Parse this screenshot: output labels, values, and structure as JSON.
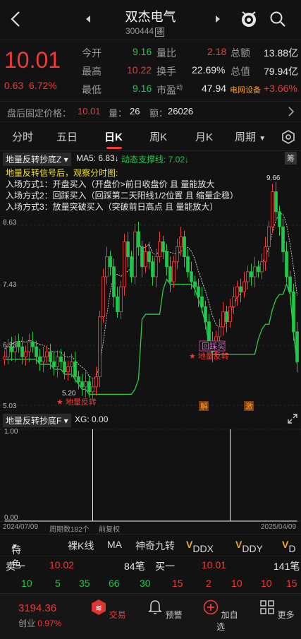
{
  "header": {
    "title": "双杰电气",
    "code": "300444",
    "tong_badge": "通"
  },
  "quote": {
    "price": "10.01",
    "change": "0.63",
    "change_pct": "6.72%",
    "open_label": "今开",
    "open": "9.16",
    "high_label": "最高",
    "high": "10.22",
    "low_label": "最低",
    "low": "9.16",
    "ratio_label": "量比",
    "ratio": "2.18",
    "turnover_label": "换手",
    "turnover": "22.69%",
    "pe_label": "市盈",
    "pe_sup": "动",
    "pe": "47.94",
    "amount_label": "总额",
    "amount": "13.88亿",
    "mktcap_label": "总值",
    "mktcap": "79.94亿",
    "sector": "电网设备",
    "sector_chg": "+3.66%"
  },
  "afterhours": {
    "label": "盘后固定价格：",
    "price": "10.01",
    "vol_label": "量：",
    "vol": "26",
    "amt_label": "额：",
    "amt": "26026"
  },
  "tabs": [
    "分时",
    "五日",
    "日K",
    "周K",
    "月K",
    "周期"
  ],
  "indicator": {
    "name": "地量反转抄底Z",
    "ma5": "MA5: 6.83↓",
    "support": "动态支撑线: 7.02↓",
    "notes": [
      "地量反转信号后，观察分时图:",
      "入场方式1：开盘买入（开盘价>前日收盘价 且 量能放大",
      "入场方式2：回踩买入（回踩第二天阳线1/2位置 且 缩量企稳）",
      "入场方式3：放量突破买入（突破前日高点 且 量能放大）"
    ],
    "right_badge": "筹"
  },
  "chart_labels": {
    "y_top": "8.63",
    "y_mid": "7.43",
    "y_low": "6.23",
    "y_bottom": "5.03",
    "high": "9.66",
    "low": "5.20",
    "signal1": "★ 地量反转",
    "signal2": "★ 地量反转",
    "retest": "回踩买",
    "mark1": "解",
    "mark2": "激"
  },
  "sub_indicator": {
    "name": "地量反转抄底F",
    "xg": "XG: 0.00",
    "y1": "1.00",
    "y0": "0.00",
    "date_start": "2024/07/09",
    "period": "周期数182个",
    "adj": "前复权",
    "date_end": "2025/04/09"
  },
  "toolbar": {
    "feature": "特色",
    "items": [
      "裸K线",
      "MA",
      "神奇九转",
      "DDX",
      "DDY",
      "D"
    ]
  },
  "orderbook": {
    "sell_label": "卖一",
    "sell_price": "10.02",
    "sell_vol": "84笔",
    "buy_label": "买一",
    "buy_price": "10.01",
    "buy_vol": "141笔",
    "sell_nums": [
      "10",
      "5",
      "35",
      "66",
      "30"
    ],
    "buy_nums": [
      "15",
      "2",
      "10",
      "10",
      "15"
    ]
  },
  "nav": {
    "index_value": "3194.36",
    "index_name": "创业",
    "index_chg": "0.97%",
    "items": [
      "交易",
      "预警",
      "加自选",
      "更多"
    ]
  },
  "chart_data": {
    "type": "candlestick",
    "title": "",
    "y_ticks": [
      5.03,
      6.23,
      7.43,
      8.63
    ],
    "ylim": [
      5.03,
      9.83
    ],
    "x_range": [
      "2024/07/09",
      "2025/04/09"
    ],
    "annotations": [
      {
        "text": "9.66",
        "note": "high"
      },
      {
        "text": "5.20",
        "note": "low"
      },
      {
        "text": "★ 地量反转"
      },
      {
        "text": "回踩买"
      }
    ],
    "series": [
      {
        "name": "MA5",
        "last": 6.83
      },
      {
        "name": "动态支撑线",
        "last": 7.02
      }
    ],
    "closes": [
      6.0,
      6.2,
      6.1,
      6.3,
      6.2,
      6.0,
      6.1,
      6.3,
      6.2,
      6.0,
      5.9,
      6.0,
      6.1,
      5.9,
      5.8,
      6.0,
      5.9,
      5.7,
      5.8,
      5.9,
      5.6,
      5.5,
      5.4,
      5.5,
      5.3,
      5.4,
      5.6,
      6.8,
      7.6,
      8.0,
      7.8,
      7.2,
      6.9,
      7.4,
      8.3,
      8.0,
      7.6,
      8.5,
      8.2,
      7.8,
      8.1,
      7.9,
      7.6,
      8.0,
      8.3,
      8.1,
      7.8,
      7.5,
      7.9,
      8.2,
      8.4,
      8.0,
      7.7,
      7.5,
      7.4,
      7.2,
      7.0,
      6.7,
      6.3,
      6.1,
      6.4,
      6.6,
      6.9,
      6.7,
      7.0,
      7.2,
      7.4,
      7.3,
      7.5,
      7.7,
      7.6,
      7.8,
      7.7,
      7.9,
      8.2,
      8.6,
      9.3,
      8.9,
      8.6,
      8.1,
      7.6,
      7.3,
      6.5,
      5.9
    ]
  }
}
